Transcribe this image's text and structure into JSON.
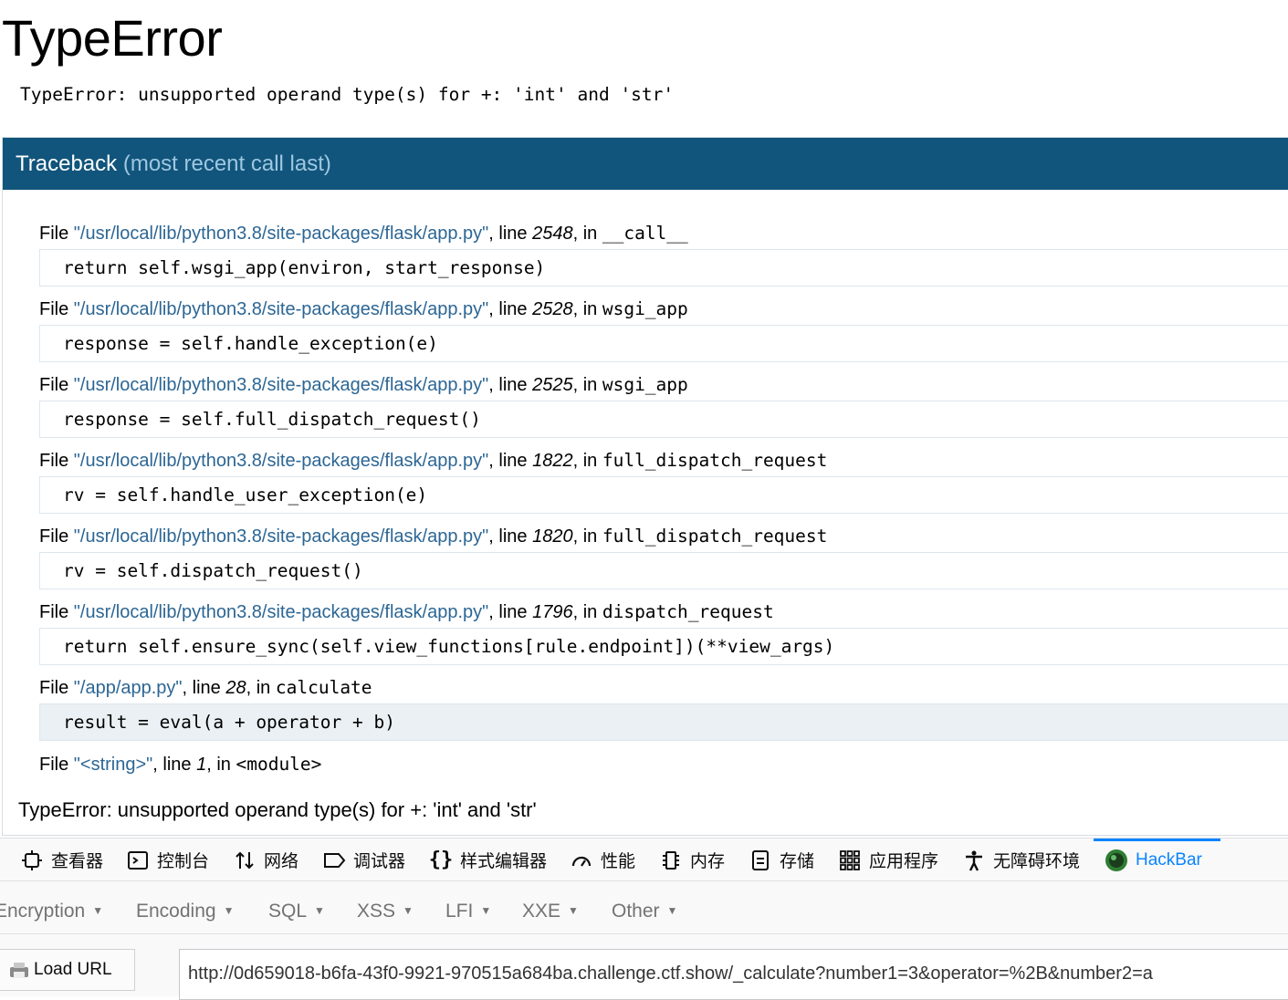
{
  "page": {
    "title": "TypeError",
    "error_message": "TypeError: unsupported operand type(s) for +: 'int' and 'str'"
  },
  "traceback": {
    "header": "Traceback",
    "header_note": "(most recent call last)",
    "file_word": "File",
    "line_word": "line",
    "in_word": "in",
    "frames": [
      {
        "file": "\"/usr/local/lib/python3.8/site-packages/flask/app.py\"",
        "line": "2548",
        "function": "__call__",
        "code": "return self.wsgi_app(environ, start_response)"
      },
      {
        "file": "\"/usr/local/lib/python3.8/site-packages/flask/app.py\"",
        "line": "2528",
        "function": "wsgi_app",
        "code": "response = self.handle_exception(e)"
      },
      {
        "file": "\"/usr/local/lib/python3.8/site-packages/flask/app.py\"",
        "line": "2525",
        "function": "wsgi_app",
        "code": "response = self.full_dispatch_request()"
      },
      {
        "file": "\"/usr/local/lib/python3.8/site-packages/flask/app.py\"",
        "line": "1822",
        "function": "full_dispatch_request",
        "code": "rv = self.handle_user_exception(e)"
      },
      {
        "file": "\"/usr/local/lib/python3.8/site-packages/flask/app.py\"",
        "line": "1820",
        "function": "full_dispatch_request",
        "code": "rv = self.dispatch_request()"
      },
      {
        "file": "\"/usr/local/lib/python3.8/site-packages/flask/app.py\"",
        "line": "1796",
        "function": "dispatch_request",
        "code": "return self.ensure_sync(self.view_functions[rule.endpoint])(**view_args)"
      },
      {
        "file": "\"/app/app.py\"",
        "line": "28",
        "function": "calculate",
        "code": "result = eval(a + operator + b)"
      }
    ],
    "last_frame": {
      "file": "\"<string>\"",
      "line": "1",
      "function": "<module>"
    },
    "final_error": "TypeError: unsupported operand type(s) for +: 'int' and 'str'"
  },
  "devtools": {
    "tabs": [
      {
        "label": "查看器",
        "icon": "inspector-icon"
      },
      {
        "label": "控制台",
        "icon": "console-icon"
      },
      {
        "label": "网络",
        "icon": "network-icon"
      },
      {
        "label": "调试器",
        "icon": "debugger-icon"
      },
      {
        "label": "样式编辑器",
        "icon": "style-editor-icon"
      },
      {
        "label": "性能",
        "icon": "performance-icon"
      },
      {
        "label": "内存",
        "icon": "memory-icon"
      },
      {
        "label": "存储",
        "icon": "storage-icon"
      },
      {
        "label": "应用程序",
        "icon": "application-icon"
      },
      {
        "label": "无障碍环境",
        "icon": "accessibility-icon"
      },
      {
        "label": "HackBar",
        "icon": "hackbar-icon",
        "active": true
      }
    ],
    "active_color": "#0a84ff"
  },
  "hackbar": {
    "menus": [
      "Encryption",
      "Encoding",
      "SQL",
      "XSS",
      "LFI",
      "XXE",
      "Other"
    ],
    "load_url_label": "Load URL",
    "url_value": "http://0d659018-b6fa-43f0-9921-970515a684ba.challenge.ctf.show/_calculate?number1=3&operator=%2B&number2=a"
  },
  "colors": {
    "header_bg": "#11557c",
    "file_link": "#2c6694",
    "current_line_bg": "#eaf0f3"
  }
}
